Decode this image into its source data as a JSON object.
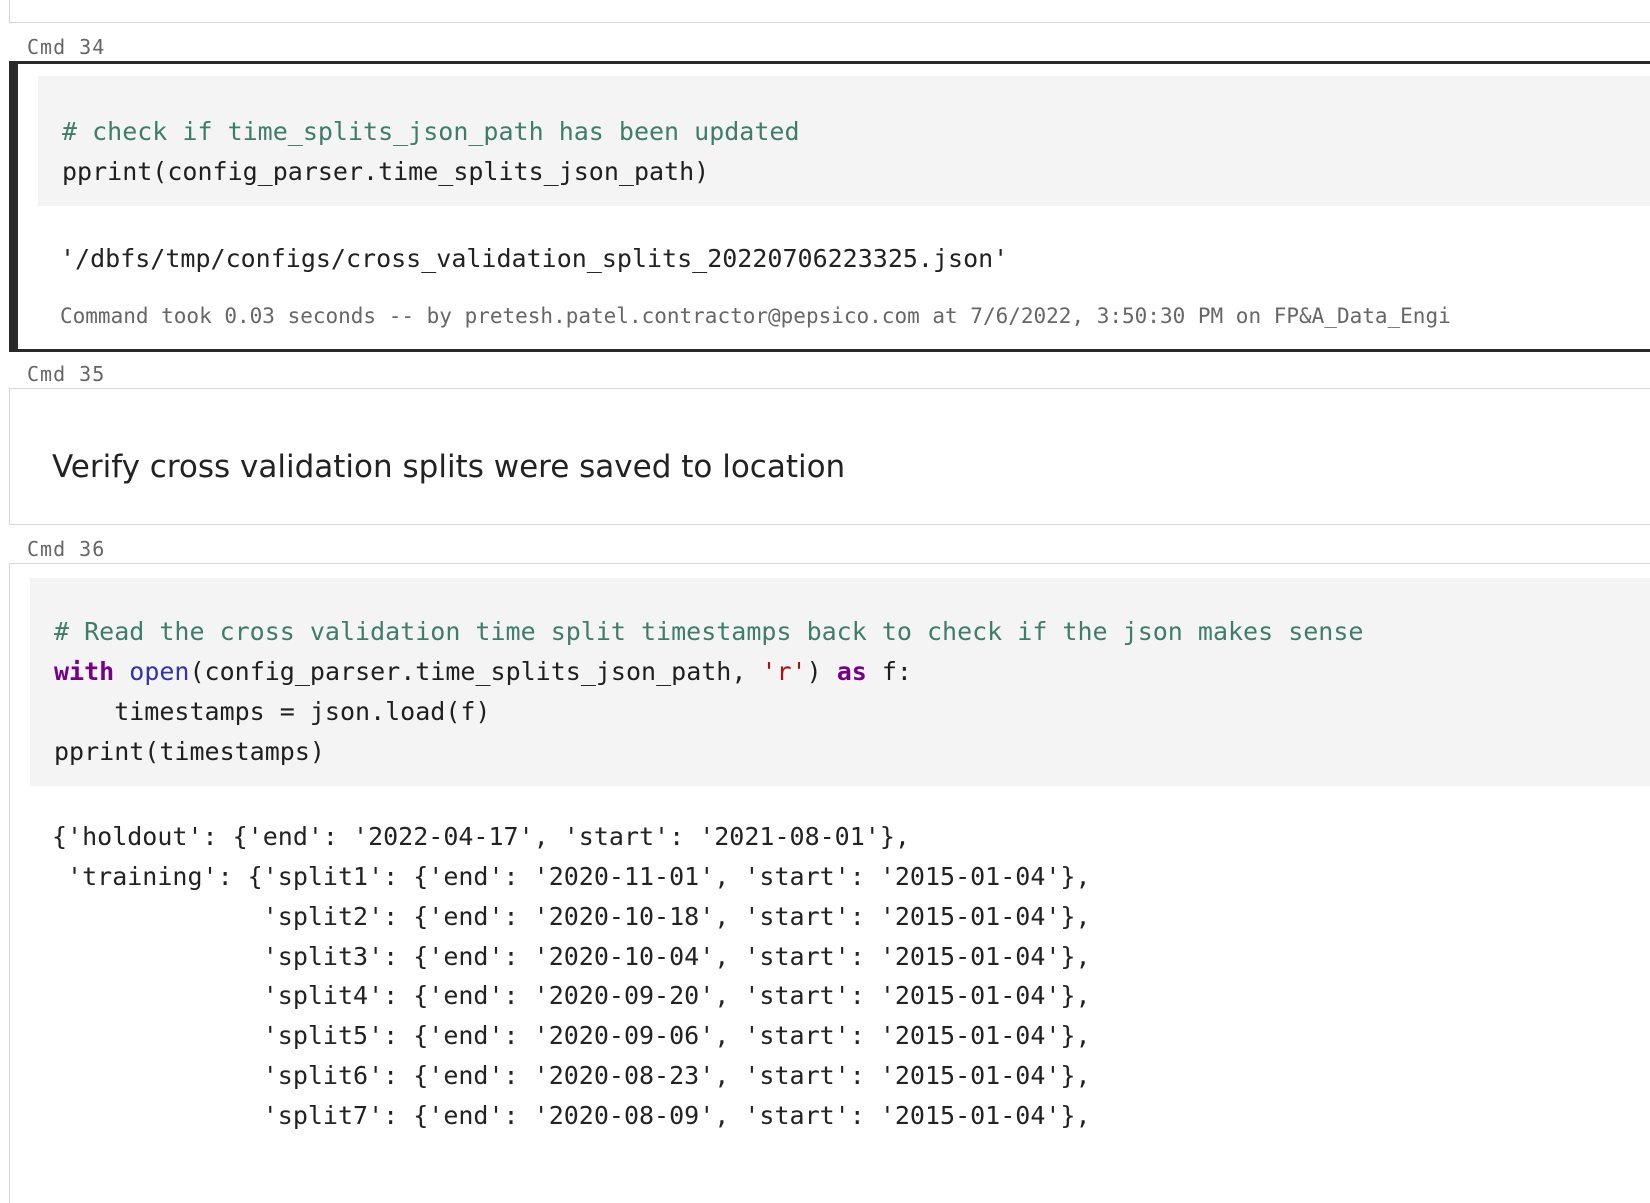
{
  "cells": {
    "cmd34": {
      "label": "Cmd 34",
      "code": {
        "comment": "# check if time_splits_json_path has been updated",
        "line2": "pprint(config_parser.time_splits_json_path)"
      },
      "output": "'/dbfs/tmp/configs/cross_validation_splits_20220706223325.json'",
      "footer": "Command took 0.03 seconds -- by pretesh.patel.contractor@pepsico.com at 7/6/2022, 3:50:30 PM on FP&A_Data_Engi"
    },
    "cmd35": {
      "label": "Cmd 35",
      "markdown": "Verify cross validation splits were saved to location"
    },
    "cmd36": {
      "label": "Cmd 36",
      "code": {
        "comment": "# Read the cross validation time split timestamps back to check if the json makes sense",
        "kw_with": "with",
        "fn_open": "open",
        "open_arg": "(config_parser.time_splits_json_path, ",
        "str_r": "'r'",
        "close_paren": ") ",
        "kw_as": "as",
        "tail": " f:",
        "line3": "    timestamps = json.load(f)",
        "line4": "pprint(timestamps)"
      },
      "output": [
        "{'holdout': {'end': '2022-04-17', 'start': '2021-08-01'},",
        " 'training': {'split1': {'end': '2020-11-01', 'start': '2015-01-04'},",
        "              'split2': {'end': '2020-10-18', 'start': '2015-01-04'},",
        "              'split3': {'end': '2020-10-04', 'start': '2015-01-04'},",
        "              'split4': {'end': '2020-09-20', 'start': '2015-01-04'},",
        "              'split5': {'end': '2020-09-06', 'start': '2015-01-04'},",
        "              'split6': {'end': '2020-08-23', 'start': '2015-01-04'},",
        "              'split7': {'end': '2020-08-09', 'start': '2015-01-04'},"
      ]
    }
  }
}
